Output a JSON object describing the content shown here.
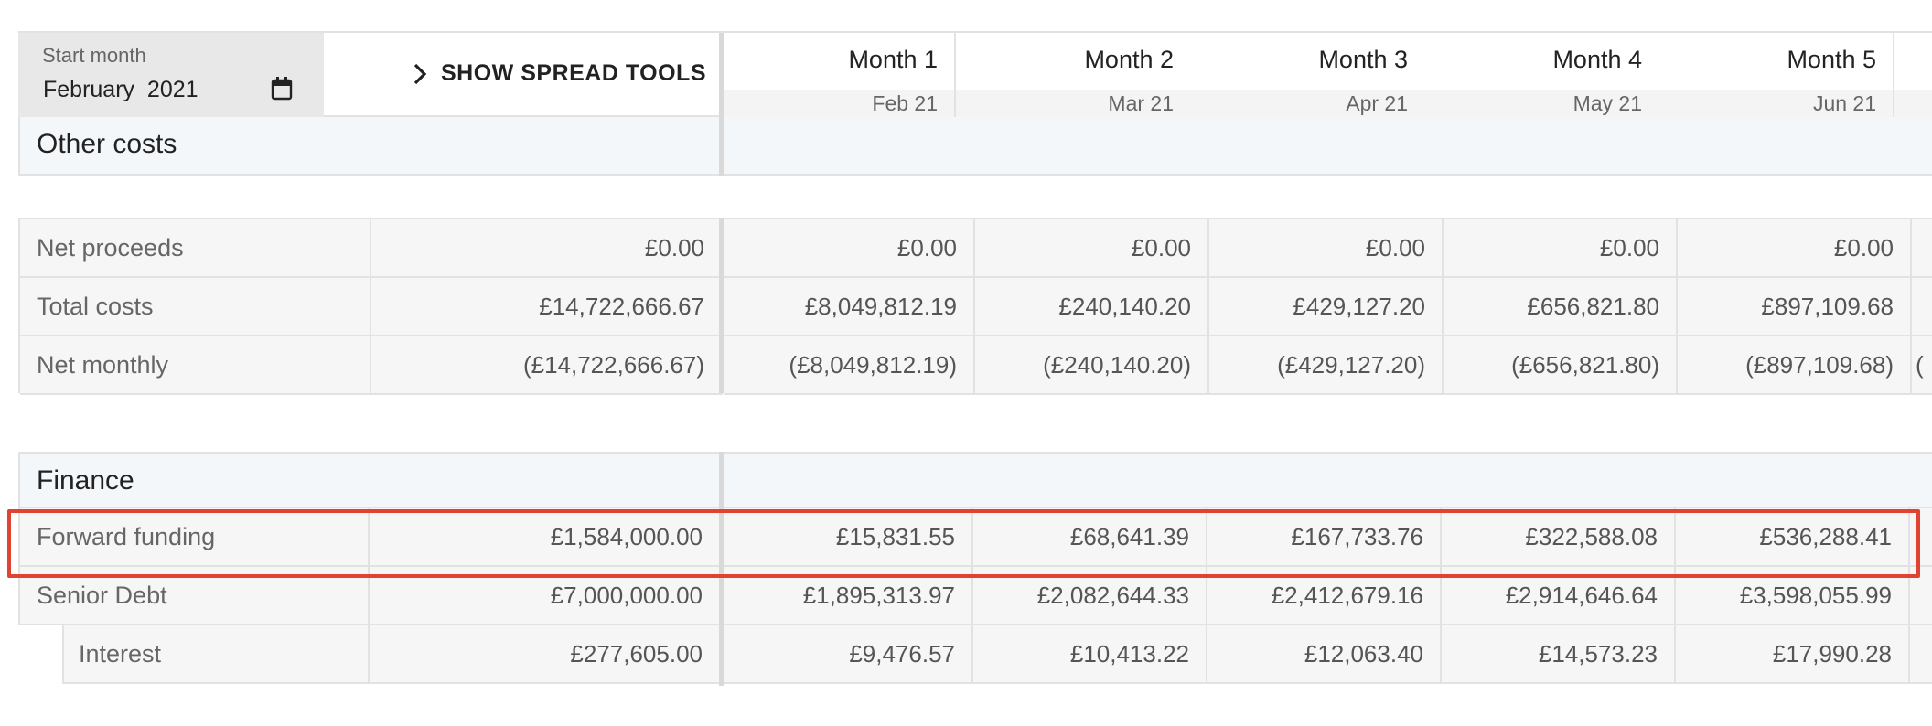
{
  "header": {
    "start_month_label": "Start month",
    "start_month_value": "February  2021",
    "spread_tools_label": "SHOW SPREAD TOOLS",
    "months": [
      {
        "label": "Month 1",
        "date": "Feb 21"
      },
      {
        "label": "Month 2",
        "date": "Mar 21"
      },
      {
        "label": "Month 3",
        "date": "Apr 21"
      },
      {
        "label": "Month 4",
        "date": "May 21"
      },
      {
        "label": "Month 5",
        "date": "Jun 21"
      }
    ]
  },
  "other_costs": {
    "title": "Other costs"
  },
  "summary": {
    "rows": [
      {
        "label": "Net proceeds",
        "total": "£0.00",
        "values": [
          "£0.00",
          "£0.00",
          "£0.00",
          "£0.00",
          "£0.00"
        ],
        "overflow": ""
      },
      {
        "label": "Total costs",
        "total": "£14,722,666.67",
        "values": [
          "£8,049,812.19",
          "£240,140.20",
          "£429,127.20",
          "£656,821.80",
          "£897,109.68"
        ],
        "overflow": ""
      },
      {
        "label": "Net monthly",
        "total": "(£14,722,666.67)",
        "values": [
          "(£8,049,812.19)",
          "(£240,140.20)",
          "(£429,127.20)",
          "(£656,821.80)",
          "(£897,109.68)"
        ],
        "overflow": "("
      }
    ]
  },
  "finance": {
    "title": "Finance",
    "rows": [
      {
        "label": "Forward funding",
        "total": "£1,584,000.00",
        "values": [
          "£15,831.55",
          "£68,641.39",
          "£167,733.76",
          "£322,588.08",
          "£536,288.41"
        ]
      },
      {
        "label": "Senior Debt",
        "total": "£7,000,000.00",
        "values": [
          "£1,895,313.97",
          "£2,082,644.33",
          "£2,412,679.16",
          "£2,914,646.64",
          "£3,598,055.99"
        ]
      },
      {
        "label": "Interest",
        "total": "£277,605.00",
        "values": [
          "£9,476.57",
          "£10,413.22",
          "£12,063.40",
          "£14,573.23",
          "£17,990.28"
        ]
      }
    ]
  },
  "colors": {
    "highlight": "#e0432f",
    "section_bg": "#f4f7fa",
    "row_bg": "#f6f6f6",
    "border": "#e2e2e2"
  }
}
